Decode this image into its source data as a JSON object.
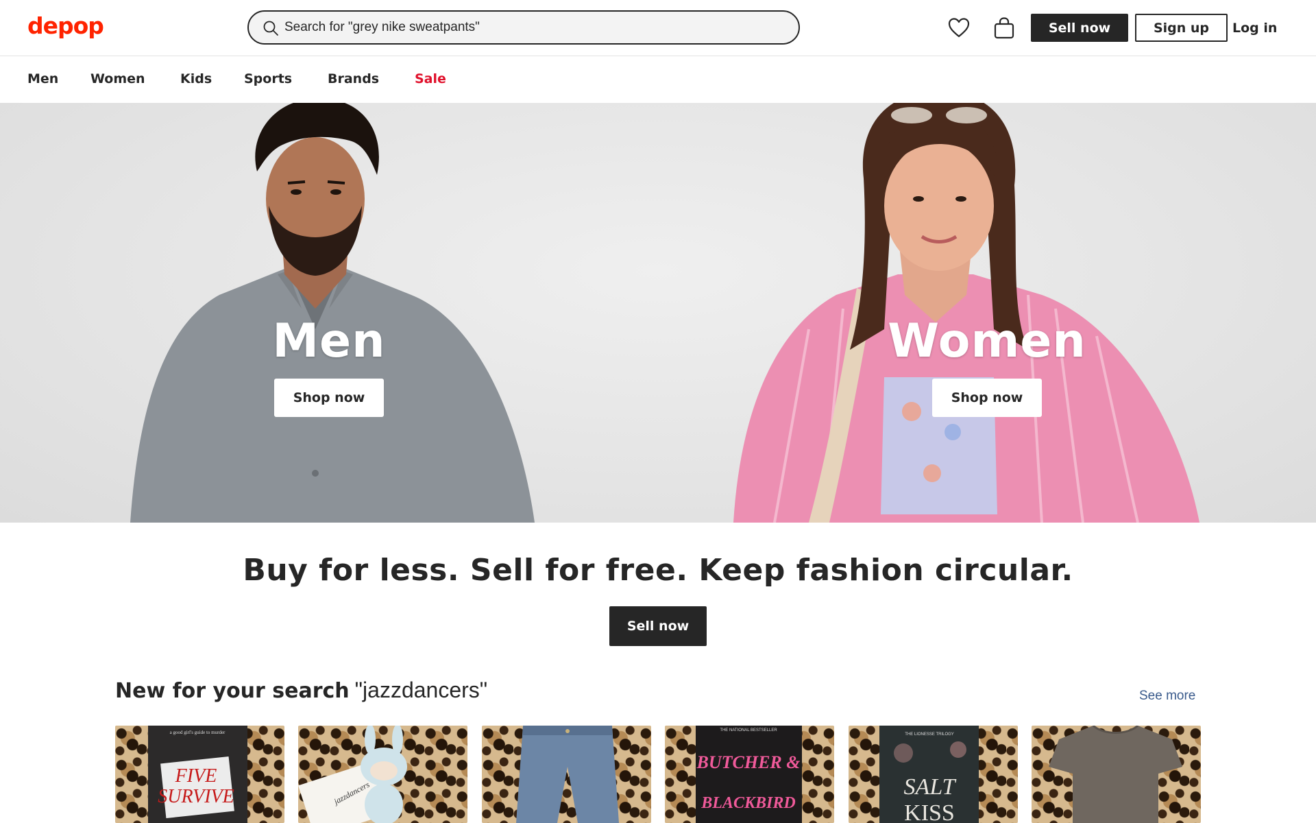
{
  "header": {
    "logo": "depop",
    "search_placeholder": "Search for \"grey nike sweatpants\"",
    "sell_now": "Sell now",
    "sign_up": "Sign up",
    "log_in": "Log in",
    "icons": [
      "search-icon",
      "heart-icon",
      "bag-icon"
    ]
  },
  "nav": {
    "items": [
      {
        "label": "Men"
      },
      {
        "label": "Women"
      },
      {
        "label": "Kids"
      },
      {
        "label": "Sports"
      },
      {
        "label": "Brands"
      },
      {
        "label": "Sale"
      }
    ]
  },
  "hero": {
    "men": {
      "title": "Men",
      "button": "Shop now"
    },
    "women": {
      "title": "Women",
      "button": "Shop now"
    }
  },
  "tagline": "Buy for less. Sell for free. Keep fashion circular.",
  "cta_sell": "Sell now",
  "recent": {
    "title": "New for your search",
    "query": "\"jazzdancers\"",
    "see_more": "See more",
    "items": [
      {
        "cover_line1": "FIVE",
        "cover_line2": "SURVIVE",
        "kicker": "a good girl's guide to murder"
      },
      {
        "note": "jazzdancers"
      },
      {},
      {
        "cover_line1": "BUTCHER &",
        "cover_line2": "BLACKBIRD",
        "kicker": "THE NATIONAL BESTSELLER"
      },
      {
        "cover_line1": "SALT",
        "cover_line2": "KISS",
        "kicker": "THE LIONESSE TRILOGY"
      },
      {}
    ]
  },
  "colors": {
    "brand": "#ff2300",
    "sale": "#e0102b",
    "dark": "#262626",
    "link": "#3a5b8c"
  }
}
